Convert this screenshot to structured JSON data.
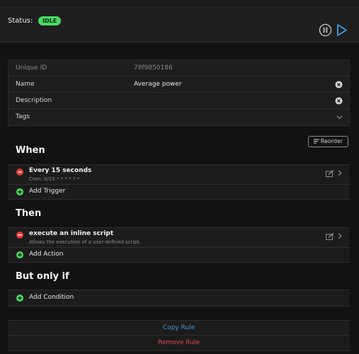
{
  "status": {
    "label": "Status:",
    "badge": "IDLE",
    "badge_color": "#4cd964",
    "controls": [
      "pause-icon",
      "play-icon"
    ],
    "play_color": "#3b9de3"
  },
  "properties": {
    "uid_label": "Unique ID",
    "uid_value": "78f9850186",
    "name_label": "Name",
    "name_value": "Average power",
    "description_label": "Description",
    "description_value": "",
    "tags_label": "Tags"
  },
  "reorder": {
    "label": "Reorder"
  },
  "when": {
    "title": "When",
    "items": [
      {
        "title": "Every 15 seconds",
        "subtitle": "Cron: 0/15 * * * * ? *"
      }
    ],
    "add_label": "Add Trigger"
  },
  "then": {
    "title": "Then",
    "items": [
      {
        "title": "execute an inline script",
        "subtitle": "Allows the execution of a user-defined script."
      }
    ],
    "add_label": "Add Action"
  },
  "but_only_if": {
    "title": "But only if",
    "add_label": "Add Condition"
  },
  "footer": {
    "copy_label": "Copy Rule",
    "remove_label": "Remove Rule"
  },
  "colors": {
    "remove": "#e53935",
    "add": "#4cd964",
    "danger_text": "#e04848",
    "link_text": "#3b9de3"
  }
}
